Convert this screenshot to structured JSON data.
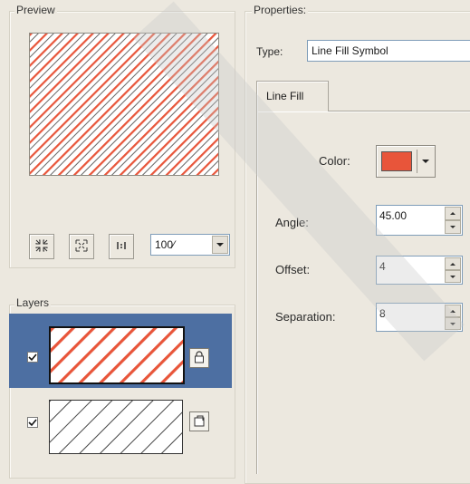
{
  "preview": {
    "group_title": "Preview",
    "zoom_value": "100⁄"
  },
  "layers": {
    "group_title": "Layers",
    "items": [
      {
        "checked": true,
        "selected": true
      },
      {
        "checked": true,
        "selected": false
      }
    ]
  },
  "properties": {
    "group_title": "Properties:",
    "type_label": "Type:",
    "type_value": "Line Fill Symbol",
    "tab_label": "Line Fill",
    "color_label": "Color:",
    "color_value": "#e8553a",
    "angle_label": "Angle:",
    "angle_value": "45.00",
    "offset_label": "Offset:",
    "offset_value": "4",
    "separation_label": "Separation:",
    "separation_value": "8"
  },
  "icons": {
    "zoom_in": "zoom-in-icon",
    "zoom_out": "zoom-out-icon",
    "actual_size": "actual-size-icon",
    "lock": "lock-icon",
    "unlock": "unlock-icon"
  },
  "colors": {
    "fill_line": "#e8553a",
    "selection": "#4d6fa2",
    "background": "#ece8df"
  }
}
